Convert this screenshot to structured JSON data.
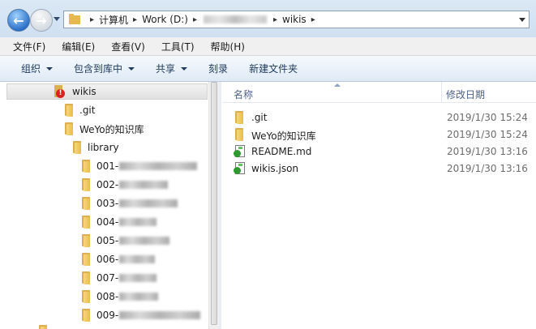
{
  "address_bar": {
    "crumbs": [
      "计算机",
      "Work (D:)",
      "wikis"
    ]
  },
  "menu": [
    "文件(F)",
    "编辑(E)",
    "查看(V)",
    "工具(T)",
    "帮助(H)"
  ],
  "toolbar": {
    "organize": "组织",
    "include_library": "包含到库中",
    "share": "共享",
    "burn": "刻录",
    "new_folder": "新建文件夹"
  },
  "tree": {
    "root": "wikis",
    "items": [
      ".git",
      "WeYo的知识库",
      "library"
    ],
    "library_children": [
      "001-",
      "002-",
      "003-",
      "004-",
      "005-",
      "006-",
      "007-",
      "008-",
      "009-"
    ]
  },
  "list": {
    "col_name": "名称",
    "col_date": "修改日期",
    "files": [
      {
        "name": ".git",
        "date": "2019/1/30 15:24",
        "icon": "folder-icon"
      },
      {
        "name": "WeYo的知识库",
        "date": "2019/1/30 15:24",
        "icon": "folder-icon"
      },
      {
        "name": "README.md",
        "date": "2019/1/30 13:16",
        "icon": "md-file-icon"
      },
      {
        "name": "wikis.json",
        "date": "2019/1/30 13:16",
        "icon": "json-file-icon"
      }
    ]
  }
}
